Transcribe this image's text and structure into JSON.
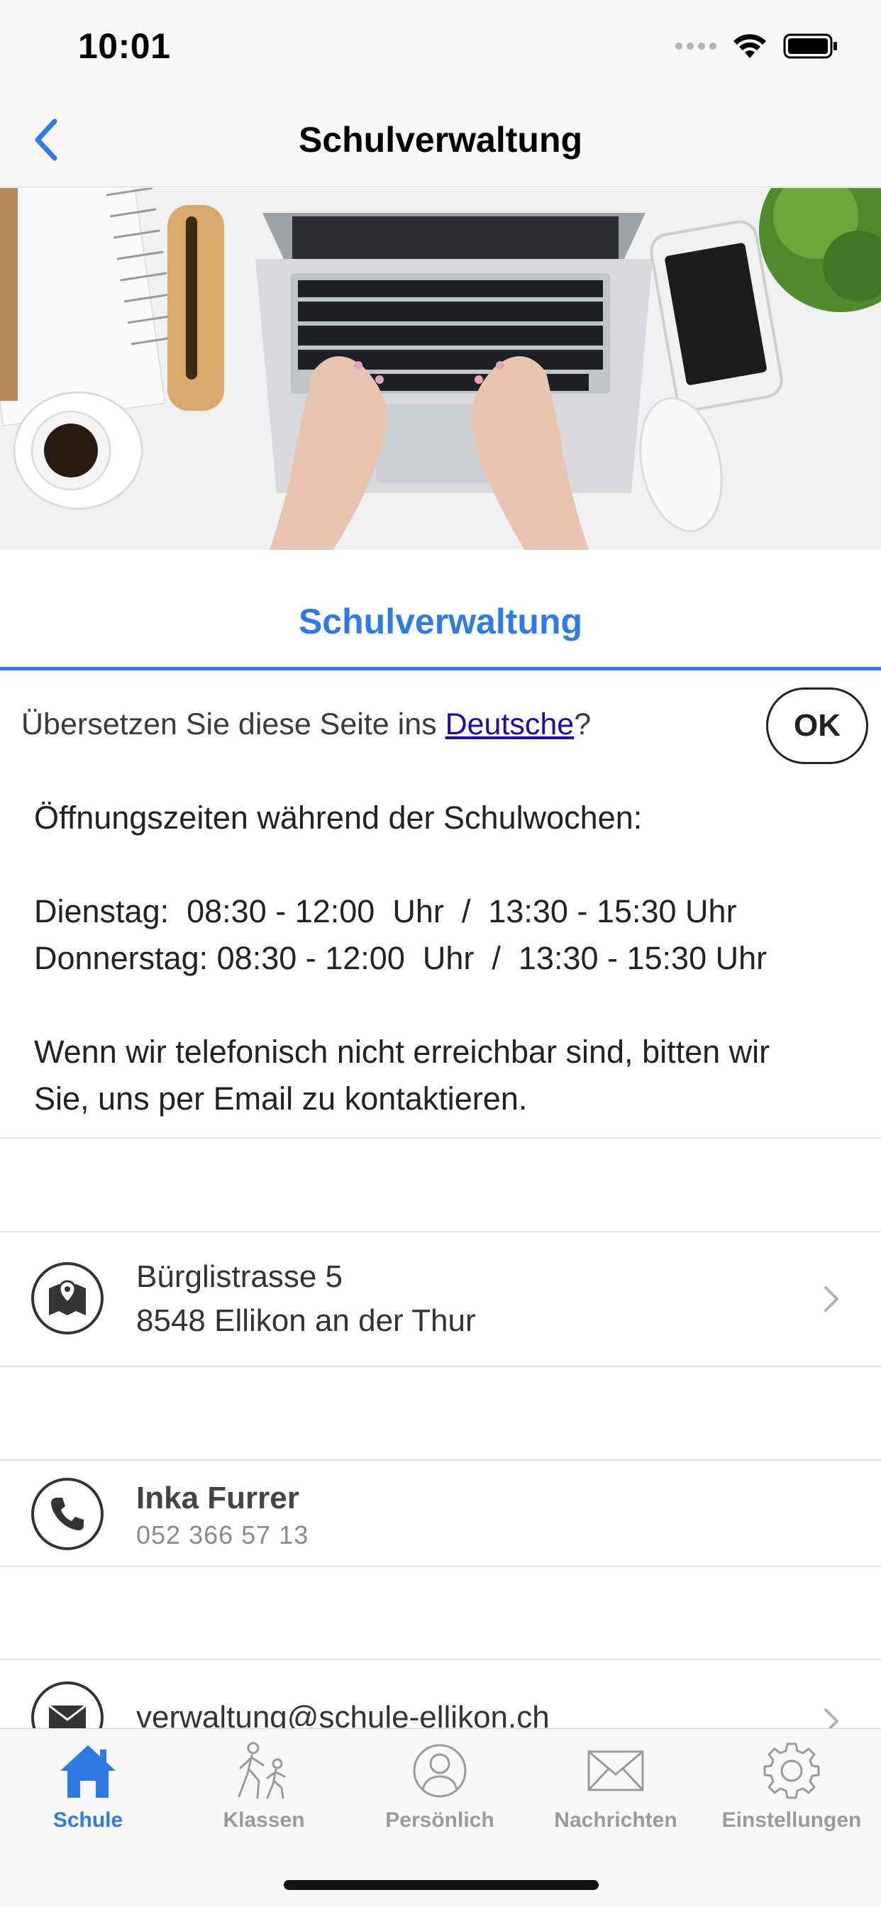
{
  "status_bar": {
    "time": "10:01"
  },
  "nav": {
    "title": "Schulverwaltung",
    "back_icon": "chevron-left-icon"
  },
  "section": {
    "heading": "Schulverwaltung"
  },
  "translate": {
    "prefix": "Übersetzen Sie diese Seite ins ",
    "link": "Deutsche",
    "suffix": "?",
    "ok": "OK"
  },
  "info": {
    "line1": "Öffnungszeiten während der Schulwochen:",
    "line2": "Dienstag:  08:30 - 12:00  Uhr  /  13:30 - 15:30 Uhr",
    "line3": "Donnerstag: 08:30 - 12:00  Uhr  /  13:30 - 15:30 Uhr",
    "line4": "Wenn wir telefonisch nicht erreichbar sind, bitten wir",
    "line5": "Sie, uns per Email zu kontaktieren."
  },
  "address": {
    "street": "Bürglistrasse 5",
    "city": "8548 Ellikon an der Thur",
    "icon": "map-pin-icon"
  },
  "contact": {
    "name": "Inka Furrer",
    "phone": "052 366 57 13",
    "icon": "phone-icon"
  },
  "email": {
    "address": "verwaltung@schule-ellikon.ch",
    "icon": "envelope-icon"
  },
  "tabs": [
    {
      "label": "Schule",
      "icon": "home-icon",
      "active": true
    },
    {
      "label": "Klassen",
      "icon": "walking-people-icon",
      "active": false
    },
    {
      "label": "Persönlich",
      "icon": "person-icon",
      "active": false
    },
    {
      "label": "Nachrichten",
      "icon": "envelope-icon",
      "active": false
    },
    {
      "label": "Einstellungen",
      "icon": "gear-icon",
      "active": false
    }
  ],
  "colors": {
    "accent": "#2f7ae5",
    "link": "#1a0dab",
    "background": "#ffffff",
    "bar": "#f7f7f7"
  }
}
